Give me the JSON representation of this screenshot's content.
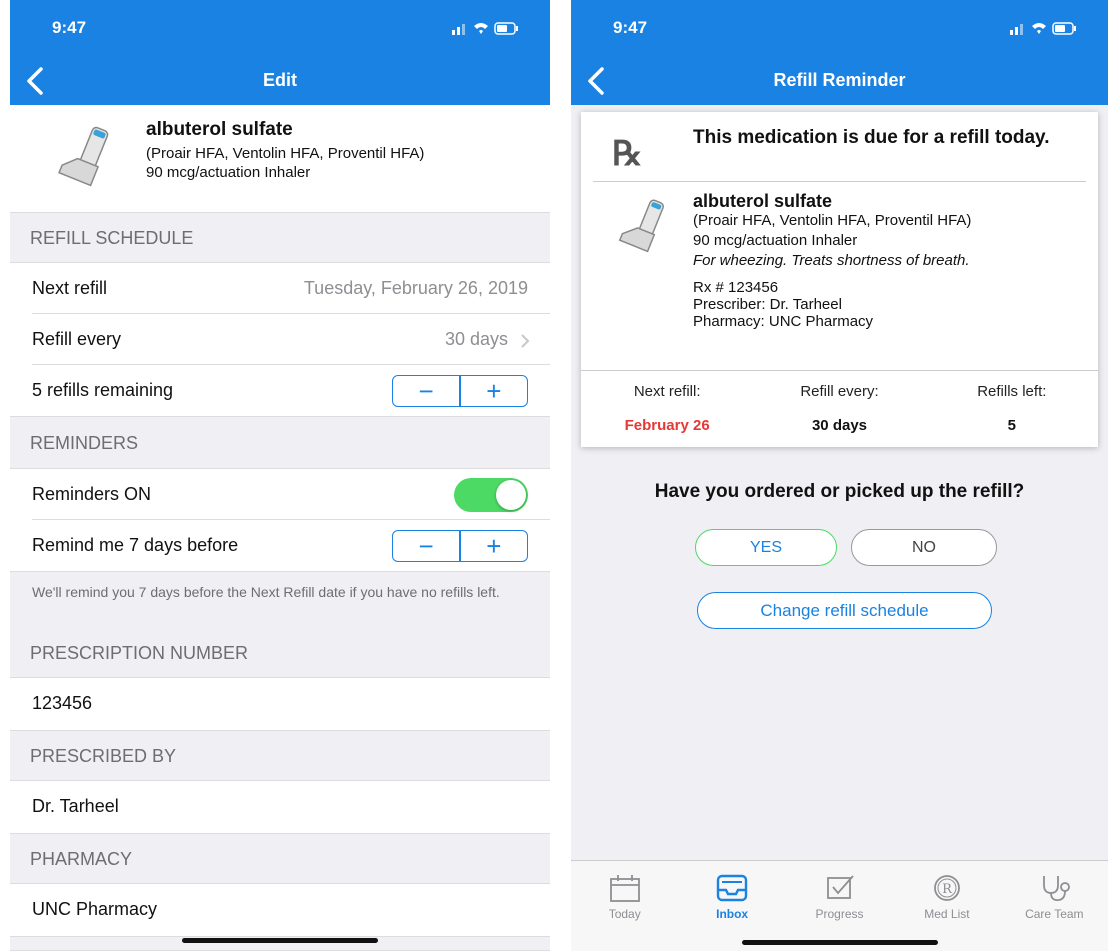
{
  "left": {
    "status": {
      "time": "9:47"
    },
    "nav": {
      "title": "Edit"
    },
    "medication": {
      "name": "albuterol sulfate",
      "brands": "(Proair HFA, Ventolin HFA, Proventil HFA)",
      "dose": "90 mcg/actuation Inhaler"
    },
    "refill_schedule": {
      "header": "REFILL SCHEDULE",
      "next_refill_label": "Next refill",
      "next_refill_value": "Tuesday, February 26, 2019",
      "refill_every_label": "Refill every",
      "refill_every_value": "30 days",
      "refills_remaining_label": "5 refills remaining"
    },
    "reminders": {
      "header": "REMINDERS",
      "on_label": "Reminders ON",
      "remind_label": "Remind me 7 days before",
      "footnote": "We'll remind you 7 days before the Next Refill date if you have no refills left."
    },
    "prescription_number": {
      "header": "PRESCRIPTION NUMBER",
      "value": "123456"
    },
    "prescribed_by": {
      "header": "PRESCRIBED BY",
      "value": "Dr. Tarheel"
    },
    "pharmacy": {
      "header": "PHARMACY",
      "value": "UNC Pharmacy"
    },
    "stepper": {
      "minus": "−",
      "plus": "+"
    }
  },
  "right": {
    "status": {
      "time": "9:47"
    },
    "nav": {
      "title": "Refill Reminder"
    },
    "card": {
      "rx_symbol": "℞",
      "due_message": "This medication is due for a refill today.",
      "name": "albuterol sulfate",
      "brands": "(Proair HFA, Ventolin HFA, Proventil HFA)",
      "dose": "90 mcg/actuation Inhaler",
      "purpose": "For wheezing. Treats shortness of breath.",
      "rx_number": "Rx # 123456",
      "prescriber": "Prescriber: Dr. Tarheel",
      "pharmacy": "Pharmacy: UNC Pharmacy",
      "next_refill_label": "Next refill:",
      "next_refill_value": "February 26",
      "refill_every_label": "Refill every:",
      "refill_every_value": "30 days",
      "refills_left_label": "Refills left:",
      "refills_left_value": "5"
    },
    "question": "Have you ordered or picked up the refill?",
    "yes_label": "YES",
    "no_label": "NO",
    "change_label": "Change refill schedule",
    "tabs": [
      {
        "label": "Today",
        "icon": "calendar-icon"
      },
      {
        "label": "Inbox",
        "icon": "inbox-icon",
        "active": true
      },
      {
        "label": "Progress",
        "icon": "checkbox-icon"
      },
      {
        "label": "Med List",
        "icon": "rx-circle-icon"
      },
      {
        "label": "Care Team",
        "icon": "stethoscope-icon"
      }
    ]
  },
  "colors": {
    "nav_blue": "#1a82e2",
    "toggle_green": "#4cd964",
    "alert_red": "#e53935",
    "group_bg": "#efeff4"
  }
}
